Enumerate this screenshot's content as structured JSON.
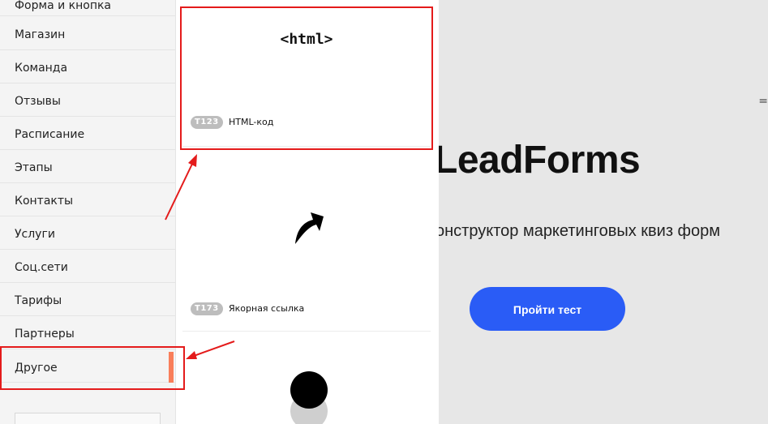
{
  "sidebar": {
    "items": [
      {
        "label": "Форма и кнопка"
      },
      {
        "label": "Магазин"
      },
      {
        "label": "Команда"
      },
      {
        "label": "Отзывы"
      },
      {
        "label": "Расписание"
      },
      {
        "label": "Этапы"
      },
      {
        "label": "Контакты"
      },
      {
        "label": "Услуги"
      },
      {
        "label": "Соц.сети"
      },
      {
        "label": "Тарифы"
      },
      {
        "label": "Партнеры"
      },
      {
        "label": "Другое",
        "active": true
      }
    ]
  },
  "blocks": [
    {
      "preview_text": "<html>",
      "code": "T123",
      "name": "HTML-код"
    },
    {
      "preview_icon": "curved-arrow-icon",
      "code": "T173",
      "name": "Якорная ссылка"
    },
    {
      "preview_icon": "circle-icon"
    }
  ],
  "preview": {
    "title": "LeadForms",
    "subtitle": "онструктор маркетинговых квиз форм",
    "cta_label": "Пройти тест"
  },
  "colors": {
    "accent": "#2a5cf6",
    "active_marker": "#f97e5a",
    "annotation": "#e41b1b",
    "badge": "#bdbdbd"
  }
}
